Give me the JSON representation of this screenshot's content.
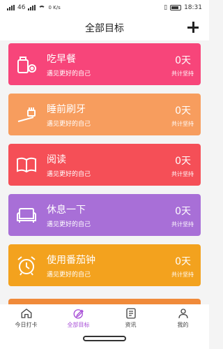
{
  "status_bar": {
    "left_text": "46",
    "speed": "0 K/s",
    "time": "18:31"
  },
  "header": {
    "title": "全部目标"
  },
  "colors": {
    "card_0": "#f7457a",
    "card_1": "#f79d5e",
    "card_2": "#f54f57",
    "card_3": "#a86fd7",
    "card_4": "#f3a21e",
    "tab_active": "#a64bd6"
  },
  "cards": [
    {
      "icon": "breakfast-icon",
      "title": "吃早餐",
      "subtitle": "遇见更好的自己",
      "days": "0天",
      "total": "共计坚持"
    },
    {
      "icon": "toothbrush-icon",
      "title": "睡前刷牙",
      "subtitle": "遇见更好的自己",
      "days": "0天",
      "total": "共计坚持"
    },
    {
      "icon": "book-icon",
      "title": "阅读",
      "subtitle": "遇见更好的自己",
      "days": "0天",
      "total": "共计坚持"
    },
    {
      "icon": "sofa-icon",
      "title": "休息一下",
      "subtitle": "遇见更好的自己",
      "days": "0天",
      "total": "共计坚持"
    },
    {
      "icon": "alarm-clock-icon",
      "title": "使用番茄钟",
      "subtitle": "遇见更好的自己",
      "days": "0天",
      "total": "共计坚持"
    }
  ],
  "tabs": [
    {
      "icon": "home-icon",
      "label": "今日打卡"
    },
    {
      "icon": "target-edit-icon",
      "label": "全部目标"
    },
    {
      "icon": "news-icon",
      "label": "资讯"
    },
    {
      "icon": "profile-icon",
      "label": "我的"
    }
  ]
}
